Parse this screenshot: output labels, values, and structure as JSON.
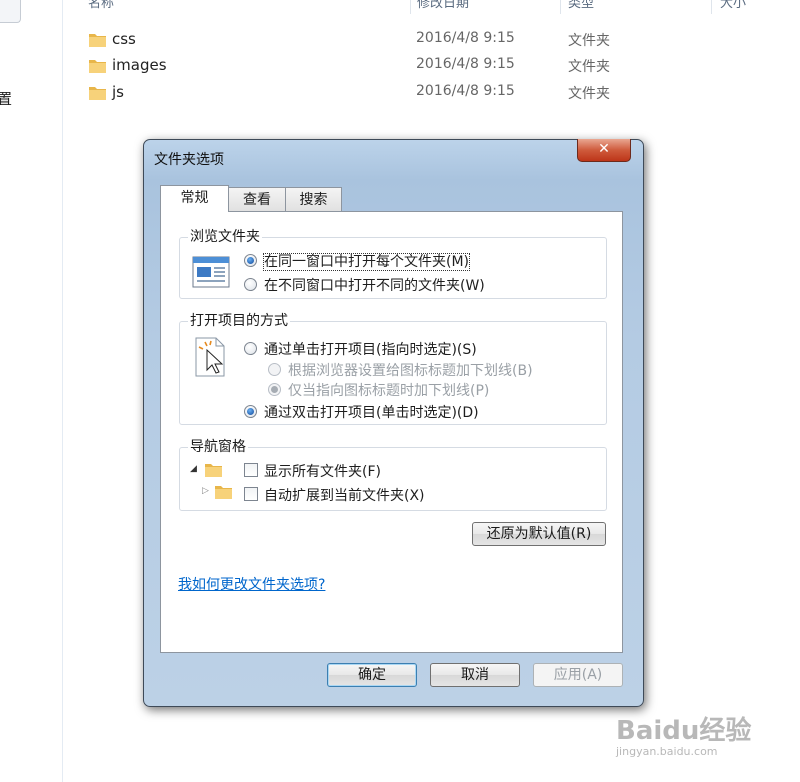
{
  "explorer": {
    "nav_text": "置",
    "columns": {
      "name": "名称",
      "date": "修改日期",
      "type": "类型",
      "size": "大小"
    },
    "files": [
      {
        "name": "css",
        "date": "2016/4/8 9:15",
        "type": "文件夹"
      },
      {
        "name": "images",
        "date": "2016/4/8 9:15",
        "type": "文件夹"
      },
      {
        "name": "js",
        "date": "2016/4/8 9:15",
        "type": "文件夹"
      }
    ]
  },
  "dialog": {
    "title": "文件夹选项",
    "close_glyph": "✕",
    "tabs": [
      {
        "label": "常规",
        "active": true
      },
      {
        "label": "查看",
        "active": false
      },
      {
        "label": "搜索",
        "active": false
      }
    ],
    "browse": {
      "title": "浏览文件夹",
      "options": [
        {
          "label": "在同一窗口中打开每个文件夹(M)",
          "checked": true
        },
        {
          "label": "在不同窗口中打开不同的文件夹(W)",
          "checked": false
        }
      ]
    },
    "click": {
      "title": "打开项目的方式",
      "single": {
        "label": "通过单击打开项目(指向时选定)(S)",
        "checked": false
      },
      "sub_options": [
        {
          "label": "根据浏览器设置给图标标题加下划线(B)",
          "checked": false,
          "enabled": false
        },
        {
          "label": "仅当指向图标标题时加下划线(P)",
          "checked": true,
          "enabled": false
        }
      ],
      "double": {
        "label": "通过双击打开项目(单击时选定)(D)",
        "checked": true
      }
    },
    "nav": {
      "title": "导航窗格",
      "options": [
        {
          "label": "显示所有文件夹(F)",
          "checked": false
        },
        {
          "label": "自动扩展到当前文件夹(X)",
          "checked": false
        }
      ]
    },
    "restore_button": "还原为默认值(R)",
    "help_link": "我如何更改文件夹选项?",
    "buttons": {
      "ok": "确定",
      "cancel": "取消",
      "apply": "应用(A)"
    }
  },
  "watermark": {
    "logo": "Baidu经验",
    "url": "jingyan.baidu.com"
  },
  "colors": {
    "accent": "#0066cc",
    "close": "#c8452a",
    "titlebar": "#b4cbe3"
  }
}
